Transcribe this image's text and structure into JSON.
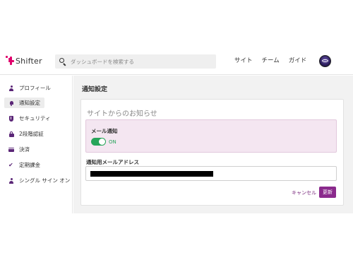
{
  "header": {
    "brand": "Shifter",
    "search_placeholder": "ダッシュボードを検索する",
    "nav": [
      "サイト",
      "チーム",
      "ガイド"
    ]
  },
  "sidebar": {
    "items": [
      {
        "label": "プロフィール",
        "icon": "person-icon",
        "active": false
      },
      {
        "label": "通知設定",
        "icon": "bell-icon",
        "active": true
      },
      {
        "label": "セキュリティ",
        "icon": "shield-icon",
        "active": false
      },
      {
        "label": "2段階認証",
        "icon": "lock-icon",
        "active": false
      },
      {
        "label": "決済",
        "icon": "credit-card-icon",
        "active": false
      },
      {
        "label": "定期課金",
        "icon": "check-icon",
        "active": false
      },
      {
        "label": "シングル サイン オン",
        "icon": "person-icon",
        "active": false
      }
    ]
  },
  "main": {
    "title": "通知設定",
    "card_title": "サイトからのお知らせ",
    "mail_label": "メール通知",
    "toggle_state": "ON",
    "email_label": "通知用メールアドレス",
    "cancel_label": "キャンセル",
    "update_label": "更新"
  },
  "colors": {
    "brand": "#e0006b",
    "accent": "#8a2a8c",
    "toggle_on": "#27a55a",
    "notice_bg": "#f4e6f1"
  }
}
